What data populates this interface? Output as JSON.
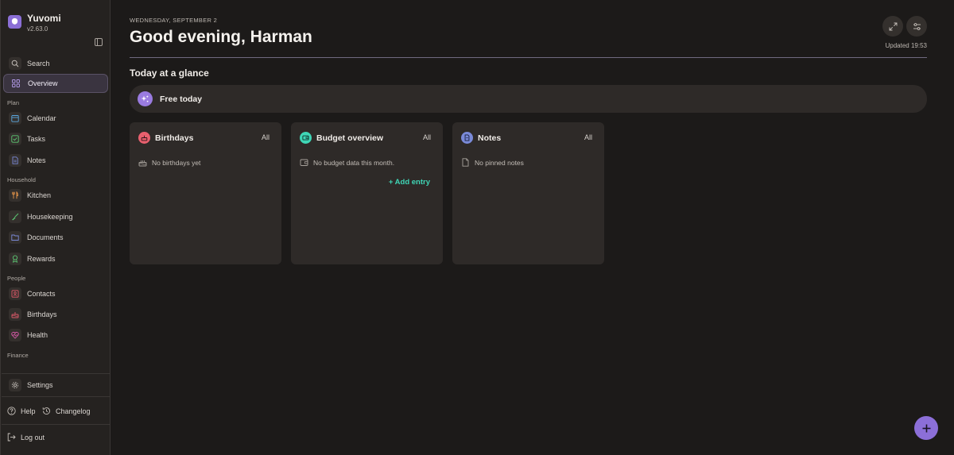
{
  "app": {
    "name": "Yuvomi",
    "version": "v2.63.0"
  },
  "sidebar": {
    "top_items": [
      {
        "label": "Search",
        "icon": "search-icon"
      },
      {
        "label": "Overview",
        "icon": "grid-icon",
        "active": true
      }
    ],
    "sections": [
      {
        "label": "Plan",
        "items": [
          {
            "label": "Calendar",
            "icon": "calendar-icon",
            "color": "#5aa8e0"
          },
          {
            "label": "Tasks",
            "icon": "check-square-icon",
            "color": "#5cc873"
          },
          {
            "label": "Notes",
            "icon": "document-icon",
            "color": "#7a8ad8"
          }
        ]
      },
      {
        "label": "Household",
        "items": [
          {
            "label": "Kitchen",
            "icon": "utensils-icon",
            "color": "#e8964a"
          },
          {
            "label": "Housekeeping",
            "icon": "broom-icon",
            "color": "#5cc873"
          },
          {
            "label": "Documents",
            "icon": "folder-icon",
            "color": "#7a8ad8"
          },
          {
            "label": "Rewards",
            "icon": "medal-icon",
            "color": "#5cc873"
          }
        ]
      },
      {
        "label": "People",
        "items": [
          {
            "label": "Contacts",
            "icon": "contact-card-icon",
            "color": "#e05a6a"
          },
          {
            "label": "Birthdays",
            "icon": "cake-icon",
            "color": "#e05a6a"
          },
          {
            "label": "Health",
            "icon": "heart-pulse-icon",
            "color": "#d85aa8"
          }
        ]
      },
      {
        "label": "Finance",
        "items": []
      }
    ],
    "footer": {
      "settings": "Settings",
      "help": "Help",
      "changelog": "Changelog",
      "logout": "Log out"
    }
  },
  "header": {
    "date": "WEDNESDAY, SEPTEMBER 2",
    "greeting": "Good evening, Harman",
    "updated": "Updated 19:53"
  },
  "glance": {
    "title": "Today at a glance",
    "free_label": "Free today"
  },
  "cards": [
    {
      "title": "Birthdays",
      "all": "All",
      "empty": "No birthdays yet",
      "icon_color": "#e8606e"
    },
    {
      "title": "Budget overview",
      "all": "All",
      "empty": "No budget data this month.",
      "action": "+ Add entry",
      "icon_color": "#3fd6b6"
    },
    {
      "title": "Notes",
      "all": "All",
      "empty": "No pinned notes",
      "icon_color": "#7a8ad8"
    }
  ],
  "colors": {
    "accent": "#8c6fd8",
    "teal": "#3fd6b6"
  }
}
